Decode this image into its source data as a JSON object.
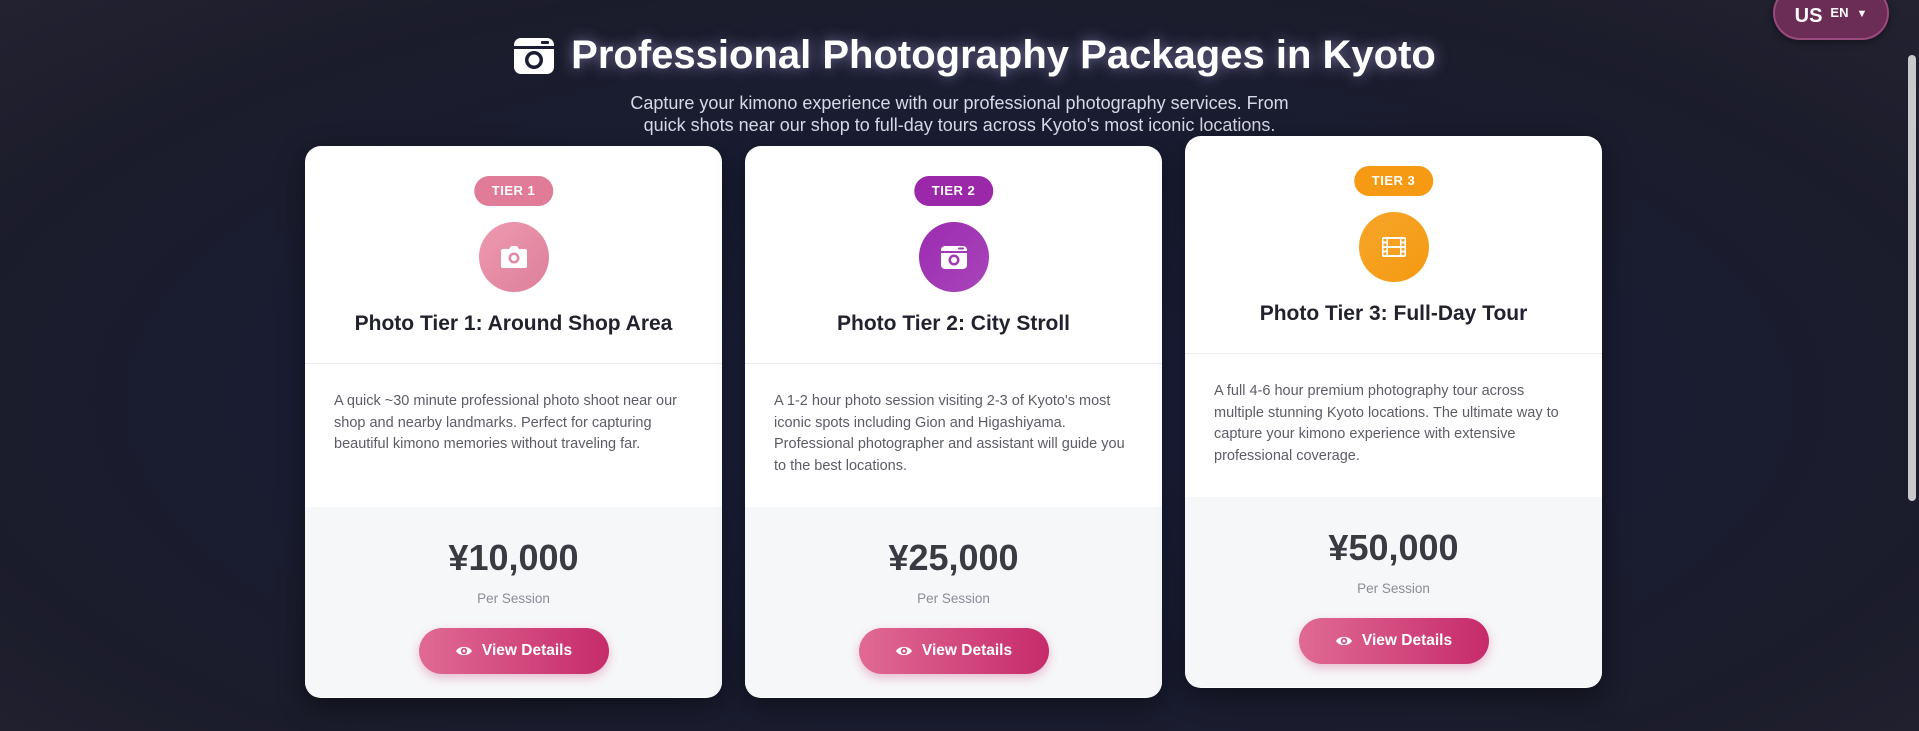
{
  "language_switcher": {
    "flag": "US",
    "code": "EN",
    "caret": "▼"
  },
  "header": {
    "icon": "camera-icon",
    "title": "Professional Photography Packages in Kyoto",
    "subtitle": "Capture your kimono experience with our professional photography services. From quick shots near our shop to full-day tours across Kyoto's most iconic locations."
  },
  "packages": [
    {
      "badge": "TIER 1",
      "icon": "camera-icon",
      "color": "#e07c98",
      "title": "Photo Tier 1: Around Shop Area",
      "description": "A quick ~30 minute professional photo shoot near our shop and nearby landmarks. Perfect for capturing beautiful kimono memories without traveling far.",
      "price": "¥10,000",
      "unit": "Per Session",
      "button": "View Details"
    },
    {
      "badge": "TIER 2",
      "icon": "camera-retro-icon",
      "color": "#9b27a9",
      "title": "Photo Tier 2: City Stroll",
      "description": "A 1-2 hour photo session visiting 2-3 of Kyoto's most iconic spots including Gion and Higashiyama. Professional photographer and assistant will guide you to the best locations.",
      "price": "¥25,000",
      "unit": "Per Session",
      "button": "View Details"
    },
    {
      "badge": "TIER 3",
      "icon": "film-icon",
      "color": "#f59a12",
      "title": "Photo Tier 3: Full-Day Tour",
      "description": "A full 4-6 hour premium photography tour across multiple stunning Kyoto locations. The ultimate way to capture your kimono experience with extensive professional coverage.",
      "price": "¥50,000",
      "unit": "Per Session",
      "button": "View Details"
    }
  ]
}
